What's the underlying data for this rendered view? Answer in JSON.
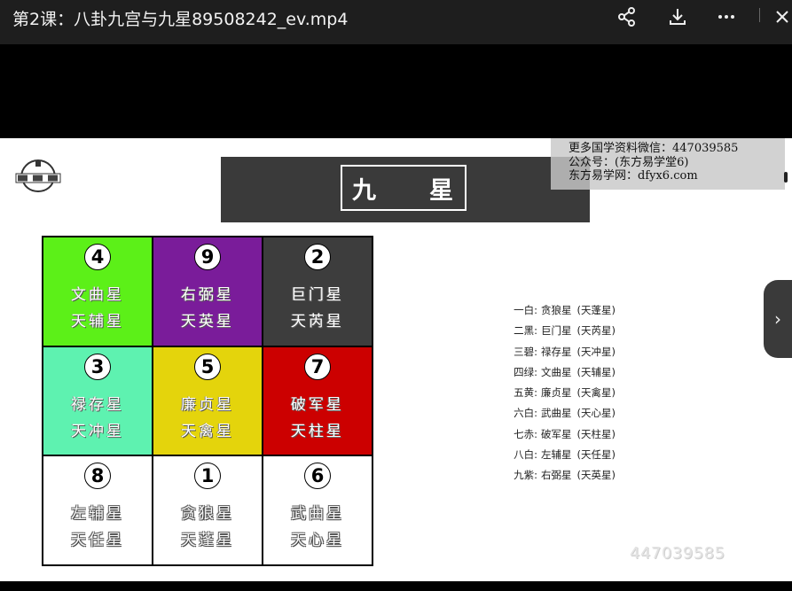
{
  "window": {
    "title": "第2课：八卦九宫与九星89508242_ev.mp4"
  },
  "toolbar": {
    "share_icon": "share-icon",
    "download_icon": "download-icon",
    "more_icon": "more-icon"
  },
  "slide": {
    "title_left": "九",
    "title_right": "星",
    "logo_label": "易文",
    "watermark": {
      "line1": "更多国学资料微信：447039585",
      "line2": "公众号：(东方易学堂6)",
      "line3": "东方易学网：dfyx6.com"
    },
    "grid": [
      {
        "num": "4",
        "name1": "文曲星",
        "name2": "天辅星",
        "color": "#5cf018"
      },
      {
        "num": "9",
        "name1": "右弼星",
        "name2": "天英星",
        "color": "#7a1c9a"
      },
      {
        "num": "2",
        "name1": "巨门星",
        "name2": "天芮星",
        "color": "#3d3d3d"
      },
      {
        "num": "3",
        "name1": "禄存星",
        "name2": "天冲星",
        "color": "#5ef2b0"
      },
      {
        "num": "5",
        "name1": "廉贞星",
        "name2": "天禽星",
        "color": "#e4d40c"
      },
      {
        "num": "7",
        "name1": "破军星",
        "name2": "天柱星",
        "color": "#cc0000"
      },
      {
        "num": "8",
        "name1": "左辅星",
        "name2": "天任星",
        "color": "#ffffff"
      },
      {
        "num": "1",
        "name1": "贪狼星",
        "name2": "天蓬星",
        "color": "#ffffff"
      },
      {
        "num": "6",
        "name1": "武曲星",
        "name2": "天心星",
        "color": "#ffffff"
      }
    ],
    "list": [
      {
        "a": "一白:",
        "b": "贪狼星",
        "c": "(天蓬星)"
      },
      {
        "a": "二黑:",
        "b": "巨门星",
        "c": "(天芮星)"
      },
      {
        "a": "三碧:",
        "b": "禄存星",
        "c": "(天冲星)"
      },
      {
        "a": "四绿:",
        "b": "文曲星",
        "c": "(天辅星)"
      },
      {
        "a": "五黄:",
        "b": "廉贞星",
        "c": "(天禽星)"
      },
      {
        "a": "六白:",
        "b": "武曲星",
        "c": "(天心星)"
      },
      {
        "a": "七赤:",
        "b": "破军星",
        "c": "(天柱星)"
      },
      {
        "a": "八白:",
        "b": "左辅星",
        "c": "(天任星)"
      },
      {
        "a": "九紫:",
        "b": "右弼星",
        "c": "(天英星)"
      }
    ],
    "bottom_watermark": "447039585"
  },
  "player": {
    "next_label": "›"
  }
}
